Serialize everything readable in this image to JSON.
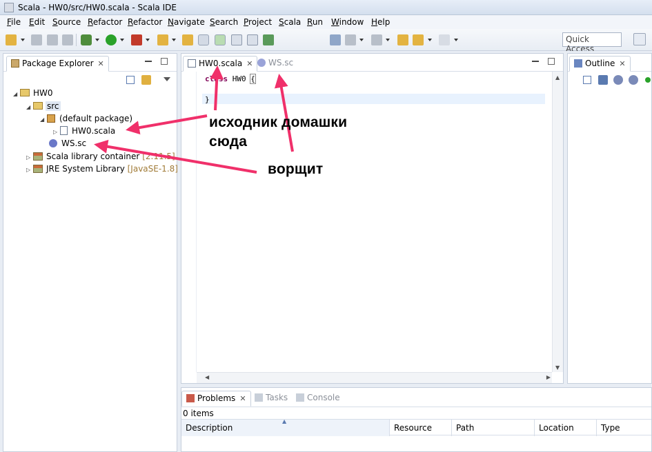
{
  "window": {
    "title": "Scala - HW0/src/HW0.scala - Scala IDE"
  },
  "menu": [
    "File",
    "Edit",
    "Source",
    "Refactor",
    "Refactor",
    "Navigate",
    "Search",
    "Project",
    "Scala",
    "Run",
    "Window",
    "Help"
  ],
  "toolbar": {
    "quick_access": "Quick Access"
  },
  "package_explorer": {
    "tab_label": "Package Explorer",
    "tree": {
      "project": "HW0",
      "src": "src",
      "default_package": "(default package)",
      "hw0_file": "HW0.scala",
      "ws_file": "WS.sc",
      "scala_lib": "Scala library container",
      "scala_lib_version": "[2.11.5]",
      "jre_lib": "JRE System Library",
      "jre_lib_version": "[JavaSE-1.8]"
    }
  },
  "editor": {
    "tabs": [
      {
        "label": "HW0.scala"
      },
      {
        "label": "WS.sc"
      }
    ],
    "code": {
      "keyword": "class",
      "name": "HW0",
      "open_brace": "{",
      "close_brace": "}"
    }
  },
  "outline": {
    "tab_label": "Outline"
  },
  "problems": {
    "tabs": [
      "Problems",
      "Tasks",
      "Console"
    ],
    "summary": "0 items",
    "columns": [
      "Description",
      "Resource",
      "Path",
      "Location",
      "Type"
    ]
  },
  "annotations": {
    "source_line1": "исходник домашки",
    "source_line2": "сюда",
    "worksheet": "ворщит"
  },
  "colors": {
    "arrow": "#f0306a",
    "keyword": "#7f0055"
  }
}
